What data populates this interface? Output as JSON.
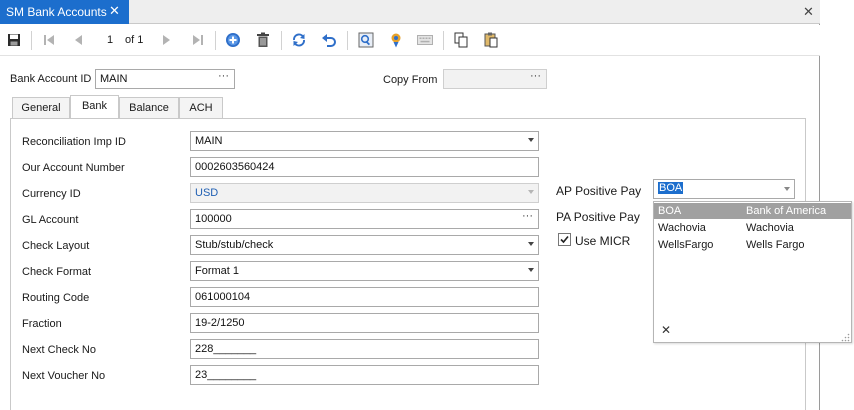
{
  "window": {
    "tab_title": "SM Bank Accounts",
    "tab_close": "✕",
    "close": "✕"
  },
  "toolbar": {
    "page_current": "1",
    "page_of": "of 1",
    "icons": [
      "save-icon",
      "first-record-icon",
      "previous-record-icon",
      "next-record-icon",
      "last-record-icon",
      "add-icon",
      "delete-icon",
      "refresh-icon",
      "undo-icon",
      "find-icon",
      "attach-icon",
      "keyboard-icon",
      "copy-icon",
      "paste-icon"
    ]
  },
  "header": {
    "bank_account_id_label": "Bank Account ID",
    "bank_account_id_value": "MAIN",
    "copy_from_label": "Copy From",
    "copy_from_value": "",
    "ellipsis": "···"
  },
  "tabs": [
    {
      "label": "General"
    },
    {
      "label": "Bank"
    },
    {
      "label": "Balance"
    },
    {
      "label": "ACH"
    }
  ],
  "form": {
    "reconciliation_imp_id": {
      "label": "Reconciliation Imp ID",
      "value": "MAIN"
    },
    "our_account_number": {
      "label": "Our Account Number",
      "value": "0002603560424"
    },
    "currency_id": {
      "label": "Currency ID",
      "value": "USD"
    },
    "gl_account": {
      "label": "GL Account",
      "value": "100000"
    },
    "check_layout": {
      "label": "Check Layout",
      "value": "Stub/stub/check"
    },
    "check_format": {
      "label": "Check Format",
      "value": "Format 1"
    },
    "routing_code": {
      "label": "Routing Code",
      "value": "061000104"
    },
    "fraction": {
      "label": "Fraction",
      "value": "19-2/1250"
    },
    "next_check_no": {
      "label": "Next Check No",
      "value": "228_______"
    },
    "next_voucher_no": {
      "label": "Next Voucher No",
      "value": "23________"
    }
  },
  "right": {
    "ap_positive_pay_label": "AP Positive Pay",
    "ap_positive_pay_value": "BOA",
    "pa_positive_pay_label": "PA Positive Pay",
    "use_micr_label": "Use MICR",
    "use_micr_checked": true
  },
  "popup": {
    "rows": [
      {
        "code": "BOA",
        "name": "Bank of America",
        "selected": true
      },
      {
        "code": "Wachovia",
        "name": "Wachovia",
        "selected": false
      },
      {
        "code": "WellsFargo",
        "name": "Wells Fargo",
        "selected": false
      }
    ],
    "clear": "✕"
  },
  "colors": {
    "accent": "#1c6ecd",
    "selected_row": "#a0a0a0",
    "highlight": "#1c6ecd"
  }
}
